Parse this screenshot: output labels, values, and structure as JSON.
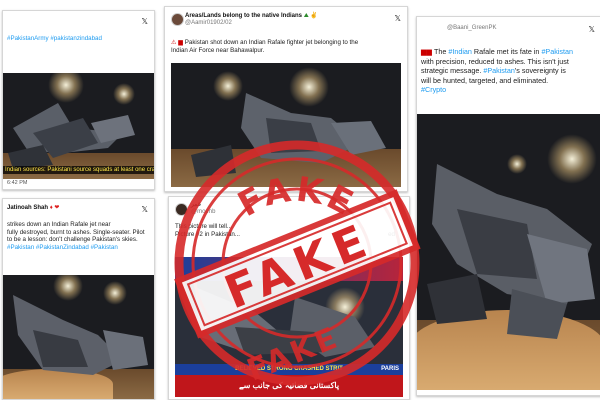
{
  "colors": {
    "stamp": "#d62a2a",
    "hashtag": "#1d9bf0",
    "news_red": "#c0161b",
    "news_blue": "#1b3f9c",
    "news_yellow": "#ffe94a"
  },
  "stamp": {
    "text_top": "FAKE",
    "text_center": "FAKE",
    "text_bottom": "FAKE"
  },
  "posts": {
    "p1": {
      "hashtags": "#PakistanArmy #pakistanzindabad",
      "subtitle": "Indian sources: Pakistani source squads at least one crashed",
      "meta": "6:42 PM",
      "icon": "x-logo-icon"
    },
    "p2": {
      "author": "Areas/Lands belong to the native Indians",
      "handle": "@Aamir01902/02",
      "text": "Pakistan shot down an Indian Rafale fighter jet belonging to the Indian Air Force near Bahawalpur.",
      "icon": "x-logo-icon"
    },
    "p3": {
      "handle": "@Baani_GreenPK",
      "line1_pre": "The ",
      "line1_tag": "#Indian",
      "line1_mid": " Rafale met its fate in ",
      "line1_tag2": "#Pakistan",
      "line2": "with precision, reduced to ashes. This isn't just",
      "line3": "strategic message. ",
      "line3_tag": "#Pakistan",
      "line3_post": "'s sovereignty is",
      "line4": "will be hunted, targeted, and eliminated.",
      "line5_tag": "#Crypto",
      "icon": "x-logo-icon"
    },
    "p4": {
      "author": "Jatinoah Shah",
      "line1": "strikes down an Indian Rafale jet near",
      "line2": "fully destroyed, burnt to ashes. Single-seater. Pilot",
      "line3": "to be a lesson: don't challenge Pakistan's skies.",
      "hashtags": "#Pakistan #PakistanZindabad #Pakistan",
      "icon": "x-logo-icon"
    },
    "p5": {
      "author": "غمر",
      "handle": "@moenb",
      "line1": "This picture will tell...",
      "line2": "Picture #2 in Pakistan...",
      "line2_end": "ed",
      "news_bar_1": "BELIEVED STRONG CRASHED STRIT",
      "news_bar_1b": "PARIS",
      "news_bar_2": "پاکستانی فضائیہ کی جانب سے",
      "icon": "x-logo-icon"
    }
  }
}
